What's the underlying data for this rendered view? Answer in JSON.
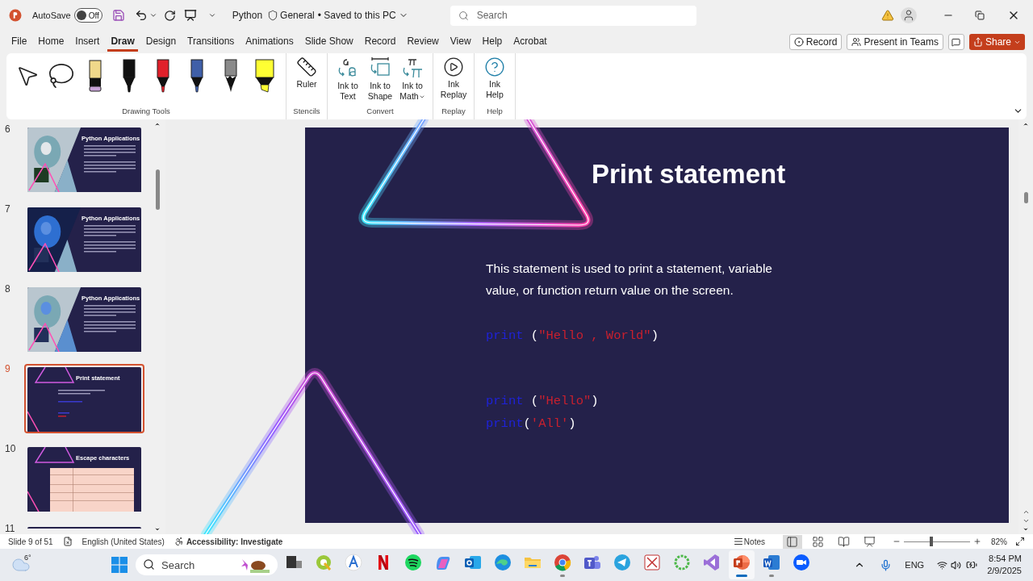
{
  "title_bar": {
    "autosave_label": "AutoSave",
    "autosave": {
      "on": false,
      "label": "Off"
    },
    "file_name": "Python",
    "sensitivity": "General",
    "save_status": "• Saved to this PC",
    "search": {
      "placeholder": "Search"
    }
  },
  "tabs": [
    {
      "label": "File",
      "selected": false
    },
    {
      "label": "Home",
      "selected": false
    },
    {
      "label": "Insert",
      "selected": false
    },
    {
      "label": "Draw",
      "selected": true
    },
    {
      "label": "Design",
      "selected": false
    },
    {
      "label": "Transitions",
      "selected": false
    },
    {
      "label": "Animations",
      "selected": false
    },
    {
      "label": "Slide Show",
      "selected": false
    },
    {
      "label": "Record",
      "selected": false
    },
    {
      "label": "Review",
      "selected": false
    },
    {
      "label": "View",
      "selected": false
    },
    {
      "label": "Help",
      "selected": false
    },
    {
      "label": "Acrobat",
      "selected": false
    }
  ],
  "tab_actions": [
    {
      "kind": "record",
      "label": "Record"
    },
    {
      "kind": "teams",
      "label": "Present in Teams"
    },
    {
      "kind": "comments"
    },
    {
      "kind": "share",
      "label": "Share"
    }
  ],
  "ribbon": {
    "groups": [
      {
        "label": "Drawing Tools",
        "items": [
          {
            "kind": "select"
          },
          {
            "kind": "lasso"
          },
          {
            "kind": "eraser",
            "color": "#f0d88a"
          },
          {
            "kind": "pen",
            "color": "#111111"
          },
          {
            "kind": "pen",
            "color": "#e0202a"
          },
          {
            "kind": "pen",
            "color": "#3f5fa8"
          },
          {
            "kind": "pencil",
            "color": "#8a8a8a"
          },
          {
            "kind": "highlighter",
            "color": "#ffff33"
          }
        ]
      },
      {
        "label": "Stencils",
        "items": [
          {
            "kind": "ruler",
            "label": "Ruler"
          }
        ]
      },
      {
        "label": "Convert",
        "items": [
          {
            "kind": "ink-to-text",
            "label": "Ink to Text"
          },
          {
            "kind": "ink-to-shape",
            "label": "Ink to Shape"
          },
          {
            "kind": "ink-to-math",
            "label": "Ink to Math"
          }
        ]
      },
      {
        "label": "Replay",
        "items": [
          {
            "kind": "replay",
            "label": "Ink Replay"
          }
        ]
      },
      {
        "label": "Help",
        "items": [
          {
            "kind": "help",
            "label": "Ink Help"
          }
        ]
      }
    ]
  },
  "slides": [
    {
      "number": "6",
      "title": "Python Applications",
      "selected": false
    },
    {
      "number": "7",
      "title": "Python Applications",
      "selected": false
    },
    {
      "number": "8",
      "title": "Python Applications",
      "selected": false
    },
    {
      "number": "9",
      "title": "Print statement",
      "kind": "text",
      "selected": true
    },
    {
      "number": "10",
      "title": "Escape characters",
      "kind": "table",
      "selected": false
    },
    {
      "number": "11",
      "kind": "cut",
      "selected": false
    }
  ],
  "slide": {
    "title": "Print statement",
    "body": "This statement is used to print a statement, variable value, or function return value on the screen.",
    "code_blocks": [
      [
        [
          {
            "kind": "keyword",
            "text": "print"
          },
          {
            "kind": "plain",
            "text": " ("
          },
          {
            "kind": "string",
            "text": "\"Hello , World\""
          },
          {
            "kind": "plain",
            "text": ")"
          }
        ]
      ],
      [
        [
          {
            "kind": "keyword",
            "text": "print"
          },
          {
            "kind": "plain",
            "text": " ("
          },
          {
            "kind": "string",
            "text": "\"Hello\""
          },
          {
            "kind": "plain",
            "text": ")"
          }
        ],
        [
          {
            "kind": "keyword",
            "text": "print"
          },
          {
            "kind": "plain",
            "text": "("
          },
          {
            "kind": "string",
            "text": "'All'"
          },
          {
            "kind": "plain",
            "text": ")"
          }
        ]
      ]
    ]
  },
  "status_bar": {
    "slide_info": "Slide 9 of 51",
    "language": "English (United States)",
    "accessibility": "Accessibility: Investigate",
    "notes": "Notes",
    "views": [
      {
        "kind": "normal",
        "selected": true
      },
      {
        "kind": "sorter",
        "selected": false
      },
      {
        "kind": "reading",
        "selected": false
      },
      {
        "kind": "slideshow",
        "selected": false
      }
    ],
    "zoom": {
      "level": 0.41,
      "reading": "82%"
    }
  },
  "taskbar": {
    "weather": "6°",
    "search": {
      "placeholder": "Search"
    },
    "apps": [
      {
        "kind": "taskview",
        "running": false,
        "selected": false
      },
      {
        "kind": "qgis",
        "running": false,
        "selected": false
      },
      {
        "kind": "badge",
        "running": false,
        "selected": false
      },
      {
        "kind": "netflix",
        "running": false,
        "selected": false
      },
      {
        "kind": "spotify",
        "running": false,
        "selected": false
      },
      {
        "kind": "copilot",
        "running": false,
        "selected": false
      },
      {
        "kind": "outlook",
        "running": false,
        "selected": false
      },
      {
        "kind": "edge",
        "running": false,
        "selected": false
      },
      {
        "kind": "files",
        "running": false,
        "selected": false
      },
      {
        "kind": "chrome",
        "running": true,
        "selected": false
      },
      {
        "kind": "teams",
        "running": false,
        "selected": false
      },
      {
        "kind": "telegram",
        "running": false,
        "selected": false
      },
      {
        "kind": "grid",
        "running": false,
        "selected": false
      },
      {
        "kind": "ring",
        "running": false,
        "selected": false
      },
      {
        "kind": "vs",
        "running": false,
        "selected": false
      },
      {
        "kind": "powerpoint",
        "running": true,
        "selected": true
      },
      {
        "kind": "word",
        "running": true,
        "selected": false
      },
      {
        "kind": "zoom",
        "running": false,
        "selected": false
      }
    ],
    "language": "ENG",
    "time": "8:54 PM",
    "date": "2/9/2025"
  }
}
